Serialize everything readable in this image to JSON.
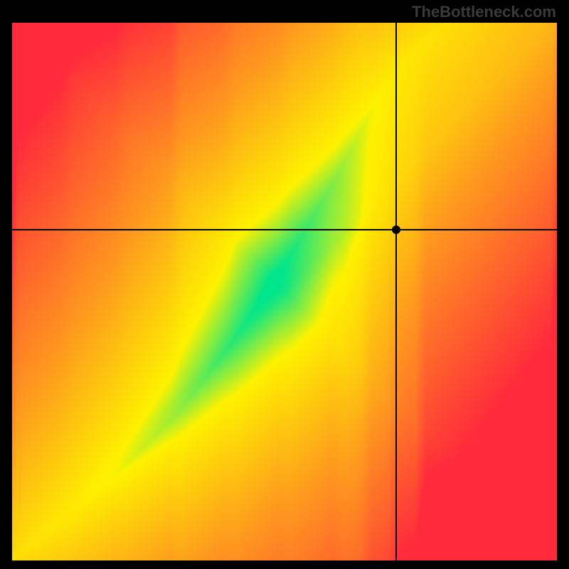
{
  "watermark": "TheBottleneck.com",
  "chart_data": {
    "type": "heatmap",
    "title": "",
    "xlabel": "",
    "ylabel": "",
    "xlim": [
      0,
      1
    ],
    "ylim": [
      0,
      1
    ],
    "color_scale": "green-yellow-orange-red (green = optimal, red = bottleneck)",
    "marker": {
      "x": 0.705,
      "y": 0.615,
      "color": "#000"
    },
    "crosshair": {
      "x": 0.705,
      "y": 0.615
    },
    "optimal_curve_samples": [
      {
        "x": 0.0,
        "y": 0.0
      },
      {
        "x": 0.1,
        "y": 0.08
      },
      {
        "x": 0.2,
        "y": 0.17
      },
      {
        "x": 0.3,
        "y": 0.27
      },
      {
        "x": 0.4,
        "y": 0.4
      },
      {
        "x": 0.5,
        "y": 0.55
      },
      {
        "x": 0.6,
        "y": 0.72
      },
      {
        "x": 0.65,
        "y": 0.82
      },
      {
        "x": 0.7,
        "y": 0.9
      },
      {
        "x": 0.75,
        "y": 0.96
      },
      {
        "x": 0.8,
        "y": 1.0
      }
    ],
    "curve_band_width_fraction": 0.06,
    "colors": {
      "optimal": "#00E68C",
      "near": "#FEF200",
      "mid": "#FF9A1F",
      "far": "#FF2A3C"
    }
  }
}
